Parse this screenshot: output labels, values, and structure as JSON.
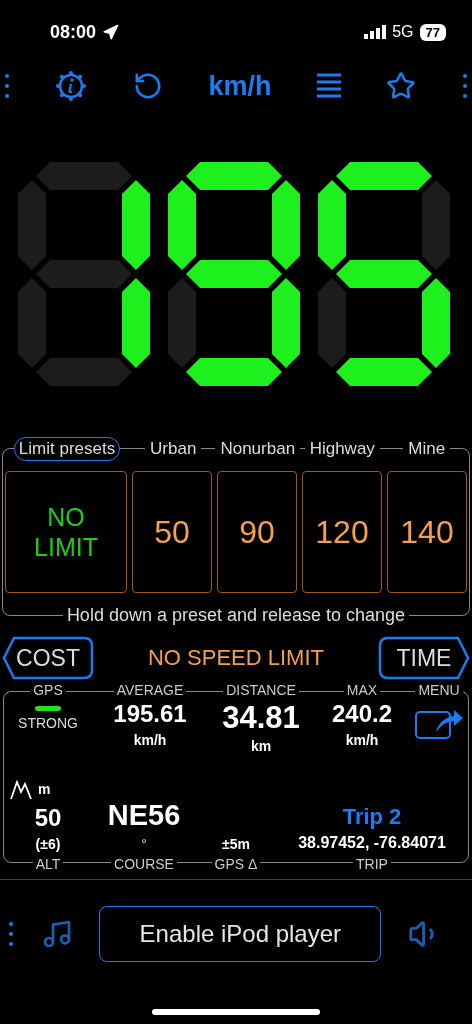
{
  "status_bar": {
    "time": "08:00",
    "network": "5G",
    "battery": "77"
  },
  "toolbar": {
    "unit": "km/h"
  },
  "speed": {
    "digits": [
      {
        "segments_lit": [
          false,
          true,
          true,
          false,
          false,
          false,
          false
        ]
      },
      {
        "segments_lit": [
          true,
          true,
          true,
          true,
          false,
          true,
          true
        ]
      },
      {
        "segments_lit": [
          true,
          false,
          true,
          true,
          false,
          true,
          true
        ]
      }
    ]
  },
  "presets": {
    "items": [
      {
        "header": "Limit presets",
        "value": "NO LIMIT",
        "selected": true
      },
      {
        "header": "Urban",
        "value": "50",
        "selected": false
      },
      {
        "header": "Nonurban",
        "value": "90",
        "selected": false
      },
      {
        "header": "Highway",
        "value": "120",
        "selected": false
      },
      {
        "header": "Mine",
        "value": "140",
        "selected": false
      }
    ],
    "hint": "Hold down a preset and release to change"
  },
  "limit_bar": {
    "left_button": "COST",
    "status": "NO SPEED LIMIT",
    "right_button": "TIME"
  },
  "stats": {
    "top_labels": [
      "GPS",
      "AVERAGE",
      "DISTANCE",
      "MAX",
      "MENU"
    ],
    "gps_strength": "STRONG",
    "average": {
      "value": "195.61",
      "unit": "km/h"
    },
    "distance": {
      "value": "34.81",
      "unit": "km"
    },
    "max": {
      "value": "240.2",
      "unit": "km/h"
    },
    "altitude": {
      "unit": "m",
      "value": "50",
      "accuracy": "(±6)"
    },
    "course": {
      "value": "NE56",
      "unit": "°"
    },
    "gps_accuracy": "±5m",
    "trip": {
      "name": "Trip 2",
      "coordinates": "38.97452, -76.84071"
    },
    "bottom_labels": [
      "ALT",
      "COURSE",
      "GPS Δ",
      "TRIP"
    ]
  },
  "player": {
    "button": "Enable iPod player"
  }
}
